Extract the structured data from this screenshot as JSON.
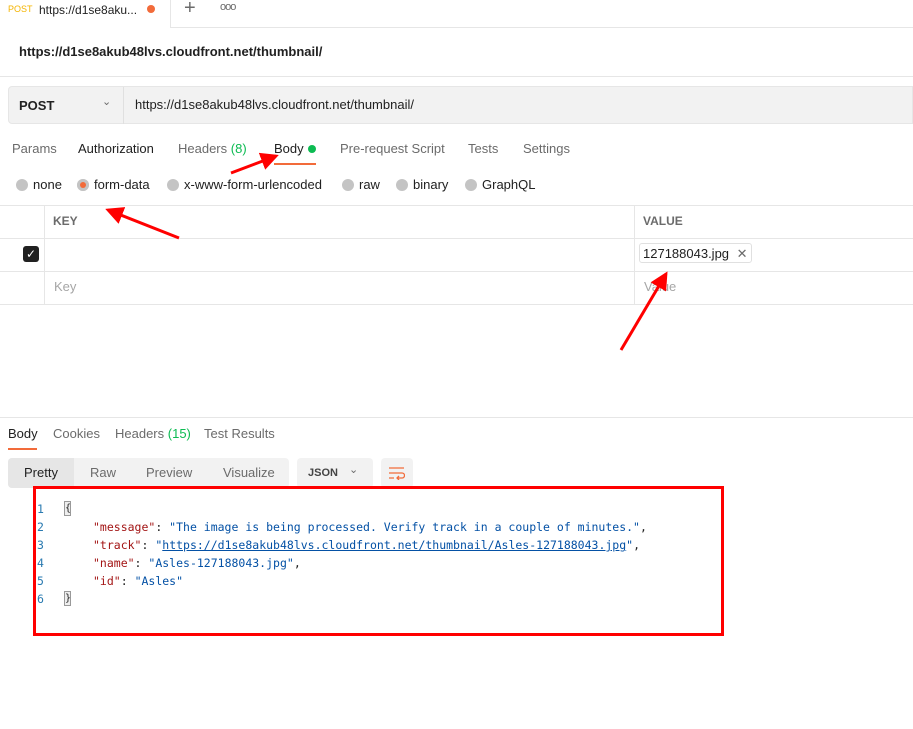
{
  "tab": {
    "method": "POST",
    "title": "https://d1se8aku...",
    "new_tab": "+",
    "more": "ooo"
  },
  "request": {
    "title": "https://d1se8akub48lvs.cloudfront.net/thumbnail/",
    "method": "POST",
    "url": "https://d1se8akub48lvs.cloudfront.net/thumbnail/"
  },
  "req_tabs": {
    "params": "Params",
    "authorization": "Authorization",
    "headers": "Headers",
    "headers_count": "(8)",
    "body": "Body",
    "prerequest": "Pre-request Script",
    "tests": "Tests",
    "settings": "Settings"
  },
  "body_types": [
    "none",
    "form-data",
    "x-www-form-urlencoded",
    "raw",
    "binary",
    "GraphQL"
  ],
  "body_type_selected": "form-data",
  "table": {
    "key_header": "KEY",
    "value_header": "VALUE",
    "rows": [
      {
        "checked": true,
        "key": "",
        "value": "127188043.jpg"
      }
    ],
    "key_placeholder": "Key",
    "value_placeholder": "Value"
  },
  "response": {
    "tabs": {
      "body": "Body",
      "cookies": "Cookies",
      "headers": "Headers",
      "headers_count": "(15)",
      "tests": "Test Results"
    },
    "views": [
      "Pretty",
      "Raw",
      "Preview",
      "Visualize"
    ],
    "format": "JSON",
    "lines": [
      "1",
      "2",
      "3",
      "4",
      "5",
      "6"
    ],
    "json": {
      "open": "{",
      "close": "}",
      "message_key": "\"message\"",
      "message_val": "\"The image is being processed. Verify track in a couple of minutes.\"",
      "track_key": "\"track\"",
      "track_val": "https://d1se8akub48lvs.cloudfront.net/thumbnail/Asles-127188043.jpg",
      "name_key": "\"name\"",
      "name_val": "\"Asles-127188043.jpg\"",
      "id_key": "\"id\"",
      "id_val": "\"Asles\""
    }
  },
  "colors": {
    "accent": "#f26b3a",
    "success": "#0cbb52",
    "annotation": "#ff0000"
  }
}
